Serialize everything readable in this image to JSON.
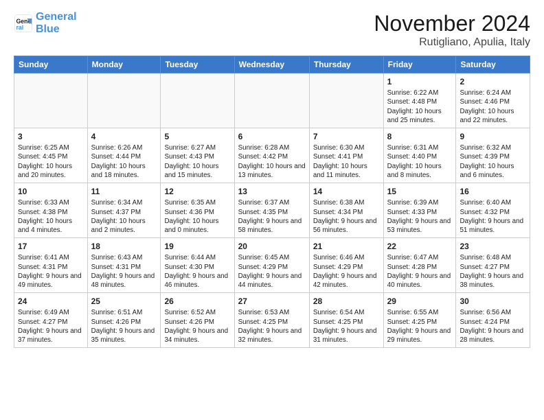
{
  "logo": {
    "line1": "General",
    "line2": "Blue"
  },
  "title": "November 2024",
  "location": "Rutigliano, Apulia, Italy",
  "headers": [
    "Sunday",
    "Monday",
    "Tuesday",
    "Wednesday",
    "Thursday",
    "Friday",
    "Saturday"
  ],
  "weeks": [
    [
      {
        "day": "",
        "detail": ""
      },
      {
        "day": "",
        "detail": ""
      },
      {
        "day": "",
        "detail": ""
      },
      {
        "day": "",
        "detail": ""
      },
      {
        "day": "",
        "detail": ""
      },
      {
        "day": "1",
        "detail": "Sunrise: 6:22 AM\nSunset: 4:48 PM\nDaylight: 10 hours and 25 minutes."
      },
      {
        "day": "2",
        "detail": "Sunrise: 6:24 AM\nSunset: 4:46 PM\nDaylight: 10 hours and 22 minutes."
      }
    ],
    [
      {
        "day": "3",
        "detail": "Sunrise: 6:25 AM\nSunset: 4:45 PM\nDaylight: 10 hours and 20 minutes."
      },
      {
        "day": "4",
        "detail": "Sunrise: 6:26 AM\nSunset: 4:44 PM\nDaylight: 10 hours and 18 minutes."
      },
      {
        "day": "5",
        "detail": "Sunrise: 6:27 AM\nSunset: 4:43 PM\nDaylight: 10 hours and 15 minutes."
      },
      {
        "day": "6",
        "detail": "Sunrise: 6:28 AM\nSunset: 4:42 PM\nDaylight: 10 hours and 13 minutes."
      },
      {
        "day": "7",
        "detail": "Sunrise: 6:30 AM\nSunset: 4:41 PM\nDaylight: 10 hours and 11 minutes."
      },
      {
        "day": "8",
        "detail": "Sunrise: 6:31 AM\nSunset: 4:40 PM\nDaylight: 10 hours and 8 minutes."
      },
      {
        "day": "9",
        "detail": "Sunrise: 6:32 AM\nSunset: 4:39 PM\nDaylight: 10 hours and 6 minutes."
      }
    ],
    [
      {
        "day": "10",
        "detail": "Sunrise: 6:33 AM\nSunset: 4:38 PM\nDaylight: 10 hours and 4 minutes."
      },
      {
        "day": "11",
        "detail": "Sunrise: 6:34 AM\nSunset: 4:37 PM\nDaylight: 10 hours and 2 minutes."
      },
      {
        "day": "12",
        "detail": "Sunrise: 6:35 AM\nSunset: 4:36 PM\nDaylight: 10 hours and 0 minutes."
      },
      {
        "day": "13",
        "detail": "Sunrise: 6:37 AM\nSunset: 4:35 PM\nDaylight: 9 hours and 58 minutes."
      },
      {
        "day": "14",
        "detail": "Sunrise: 6:38 AM\nSunset: 4:34 PM\nDaylight: 9 hours and 56 minutes."
      },
      {
        "day": "15",
        "detail": "Sunrise: 6:39 AM\nSunset: 4:33 PM\nDaylight: 9 hours and 53 minutes."
      },
      {
        "day": "16",
        "detail": "Sunrise: 6:40 AM\nSunset: 4:32 PM\nDaylight: 9 hours and 51 minutes."
      }
    ],
    [
      {
        "day": "17",
        "detail": "Sunrise: 6:41 AM\nSunset: 4:31 PM\nDaylight: 9 hours and 49 minutes."
      },
      {
        "day": "18",
        "detail": "Sunrise: 6:43 AM\nSunset: 4:31 PM\nDaylight: 9 hours and 48 minutes."
      },
      {
        "day": "19",
        "detail": "Sunrise: 6:44 AM\nSunset: 4:30 PM\nDaylight: 9 hours and 46 minutes."
      },
      {
        "day": "20",
        "detail": "Sunrise: 6:45 AM\nSunset: 4:29 PM\nDaylight: 9 hours and 44 minutes."
      },
      {
        "day": "21",
        "detail": "Sunrise: 6:46 AM\nSunset: 4:29 PM\nDaylight: 9 hours and 42 minutes."
      },
      {
        "day": "22",
        "detail": "Sunrise: 6:47 AM\nSunset: 4:28 PM\nDaylight: 9 hours and 40 minutes."
      },
      {
        "day": "23",
        "detail": "Sunrise: 6:48 AM\nSunset: 4:27 PM\nDaylight: 9 hours and 38 minutes."
      }
    ],
    [
      {
        "day": "24",
        "detail": "Sunrise: 6:49 AM\nSunset: 4:27 PM\nDaylight: 9 hours and 37 minutes."
      },
      {
        "day": "25",
        "detail": "Sunrise: 6:51 AM\nSunset: 4:26 PM\nDaylight: 9 hours and 35 minutes."
      },
      {
        "day": "26",
        "detail": "Sunrise: 6:52 AM\nSunset: 4:26 PM\nDaylight: 9 hours and 34 minutes."
      },
      {
        "day": "27",
        "detail": "Sunrise: 6:53 AM\nSunset: 4:25 PM\nDaylight: 9 hours and 32 minutes."
      },
      {
        "day": "28",
        "detail": "Sunrise: 6:54 AM\nSunset: 4:25 PM\nDaylight: 9 hours and 31 minutes."
      },
      {
        "day": "29",
        "detail": "Sunrise: 6:55 AM\nSunset: 4:25 PM\nDaylight: 9 hours and 29 minutes."
      },
      {
        "day": "30",
        "detail": "Sunrise: 6:56 AM\nSunset: 4:24 PM\nDaylight: 9 hours and 28 minutes."
      }
    ]
  ]
}
